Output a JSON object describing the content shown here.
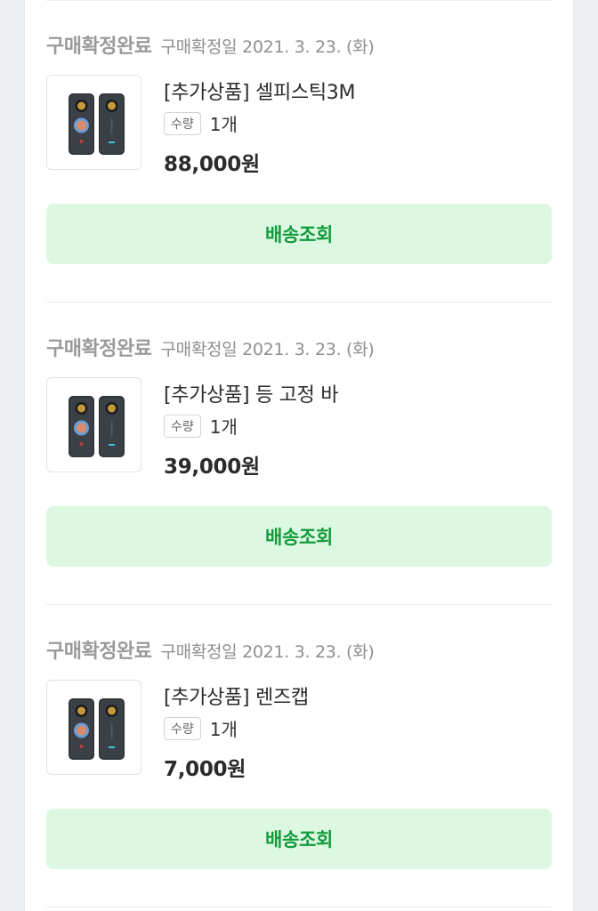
{
  "orders": [
    {
      "status_label": "구매확정완료",
      "status_date": "구매확정일 2021. 3. 23. (화)",
      "product_name": "[추가상품] 셀피스틱3M",
      "qty_label": "수량",
      "qty_value": "1개",
      "price": "88,000원",
      "track_button_label": "배송조회"
    },
    {
      "status_label": "구매확정완료",
      "status_date": "구매확정일 2021. 3. 23. (화)",
      "product_name": "[추가상품] 등 고정 바",
      "qty_label": "수량",
      "qty_value": "1개",
      "price": "39,000원",
      "track_button_label": "배송조회"
    },
    {
      "status_label": "구매확정완료",
      "status_date": "구매확정일 2021. 3. 23. (화)",
      "product_name": "[추가상품] 렌즈캡",
      "qty_label": "수량",
      "qty_value": "1개",
      "price": "7,000원",
      "track_button_label": "배송조회"
    }
  ],
  "colors": {
    "button_bg": "#dcf8e1",
    "button_text": "#129b3c",
    "status_text": "#9a9a9a"
  }
}
